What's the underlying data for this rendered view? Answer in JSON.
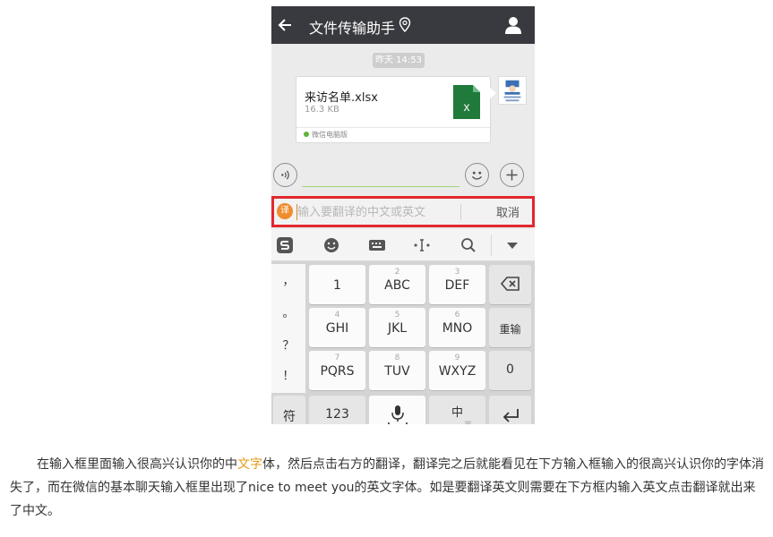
{
  "header": {
    "title": "文件传输助手",
    "back_icon": "back-arrow-icon",
    "location_icon": "location-pin-icon",
    "user_icon": "user-profile-icon",
    "bg_color": "#393a3f"
  },
  "chat": {
    "timestamp": "昨天 14:53",
    "file_card": {
      "file_name": "来访名单.xlsx",
      "file_size": "16.3 KB",
      "file_icon": "excel-file-icon",
      "source_label": "微信电脑版"
    }
  },
  "input_bar": {
    "voice_icon": "voice-icon",
    "emoji_icon": "emoji-icon",
    "plus_icon": "plus-icon",
    "message_value": "",
    "accent_color": "#9fd47a"
  },
  "translate_bar": {
    "badge": "译",
    "placeholder": "输入要翻译的中文或英文",
    "cancel_label": "取消",
    "highlight_color": "#e2282d"
  },
  "keyboard_toolbar": {
    "tools": [
      "sogou-logo-icon",
      "emoji-face-icon",
      "keyboard-icon",
      "cursor-move-icon",
      "search-icon",
      "collapse-icon"
    ]
  },
  "keyboard": {
    "symbols": [
      "，",
      "。",
      "？",
      "！"
    ],
    "keys": [
      {
        "num": "",
        "label": "1"
      },
      {
        "num": "2",
        "label": "ABC"
      },
      {
        "num": "3",
        "label": "DEF"
      },
      {
        "num": "4",
        "label": "GHI"
      },
      {
        "num": "5",
        "label": "JKL"
      },
      {
        "num": "6",
        "label": "MNO"
      },
      {
        "num": "7",
        "label": "PQRS"
      },
      {
        "num": "8",
        "label": "TUV"
      },
      {
        "num": "9",
        "label": "WXYZ"
      }
    ],
    "backspace_icon": "backspace-icon",
    "reinput_label": "重输",
    "zero_label": "0",
    "symbols_label": "符",
    "num123_label": "123",
    "mic_icon": "microphone-icon",
    "lang_label": "中",
    "lang_sub": "英",
    "enter_icon": "enter-icon"
  },
  "caption": {
    "part1": "在输入框里面输入很高兴认识你的中",
    "link": "文字",
    "part2": "体，然后点击右方的翻译，翻译完之后就能看见在下方输入框输入的很高兴认识你的字体消失了，而在微信的基本聊天输入框里出现了nice to meet you的英文字体。如是要翻译英文则需要在下方框内输入英文点击翻译就出来了中文。",
    "link_color": "#e49a16"
  }
}
